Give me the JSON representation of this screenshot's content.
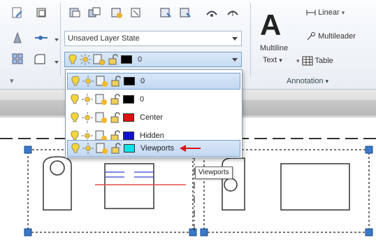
{
  "ribbon": {
    "layer_state": "Unsaved Layer State",
    "current_layer": {
      "name": "0",
      "color": "#000000"
    },
    "annotation_panel": "Annotation",
    "multiline_text_label_1": "Multiline",
    "multiline_text_label_2": "Text",
    "linear_label": "Linear",
    "multileader_label": "Multileader",
    "table_label": "Table"
  },
  "layer_dropdown": {
    "items": [
      {
        "name": "0",
        "color": "#000000",
        "selected": true
      },
      {
        "name": "0",
        "color": "#000000",
        "selected": false
      },
      {
        "name": "Center",
        "color": "#e01010",
        "selected": false
      },
      {
        "name": "Hidden",
        "color": "#1010d0",
        "selected": false
      },
      {
        "name": "Viewports",
        "color": "#00e5e5",
        "selected": true
      }
    ]
  },
  "tooltip": {
    "text": "Viewports"
  },
  "colors": {
    "accent_blue": "#3a78c9",
    "pointer_arrow": "#e0101a"
  }
}
